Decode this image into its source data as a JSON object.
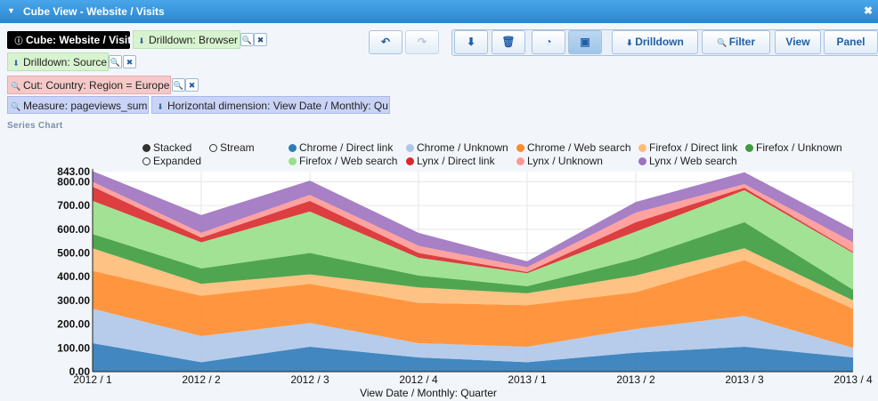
{
  "window": {
    "title": "Cube View - Website / Visits"
  },
  "chips": {
    "cube": "Cube: Website / Visits",
    "drilldown_browser": "Drilldown: Browser",
    "drilldown_source": "Drilldown: Source",
    "cut": "Cut: Country: Region = Europe",
    "measure": "Measure: pageviews_sum",
    "horizontal": "Horizontal dimension: View Date / Monthly: Qu"
  },
  "toolbar": {
    "drilldown_label": "Drilldown",
    "filter_label": "Filter",
    "view_label": "View",
    "panel_label": "Panel"
  },
  "section_title": "Series Chart",
  "chart_modes": {
    "stacked": "Stacked",
    "stream": "Stream",
    "expanded": "Expanded"
  },
  "chart_data": {
    "type": "area",
    "stacked": true,
    "xlabel": "View Date / Monthly: Quarter",
    "ylabel": "",
    "ylim": [
      0,
      843
    ],
    "y_top_label": "843.00",
    "y_ticks": [
      "0.00",
      "100.00",
      "200.00",
      "300.00",
      "400.00",
      "500.00",
      "600.00",
      "700.00",
      "800.00"
    ],
    "categories": [
      "2012 / 1",
      "2012 / 2",
      "2012 / 3",
      "2012 / 4",
      "2013 / 1",
      "2013 / 2",
      "2013 / 3",
      "2013 / 4"
    ],
    "series": [
      {
        "name": "Chrome / Direct link",
        "color": "#2e7ab8",
        "values": [
          120,
          40,
          105,
          60,
          40,
          80,
          105,
          60
        ]
      },
      {
        "name": "Chrome / Unknown",
        "color": "#aec7e8",
        "values": [
          145,
          110,
          100,
          60,
          65,
          100,
          130,
          40
        ]
      },
      {
        "name": "Chrome / Web search",
        "color": "#ff8b2a",
        "values": [
          160,
          170,
          165,
          170,
          175,
          155,
          235,
          165
        ]
      },
      {
        "name": "Firefox / Direct link",
        "color": "#ffbb78",
        "values": [
          95,
          50,
          40,
          65,
          50,
          70,
          50,
          35
        ]
      },
      {
        "name": "Firefox / Unknown",
        "color": "#3d9c3d",
        "values": [
          60,
          65,
          90,
          50,
          30,
          70,
          110,
          45
        ]
      },
      {
        "name": "Firefox / Web search",
        "color": "#98df8a",
        "values": [
          140,
          110,
          175,
          75,
          55,
          115,
          135,
          155
        ]
      },
      {
        "name": "Lynx / Direct link",
        "color": "#d9292b",
        "values": [
          60,
          20,
          45,
          20,
          5,
          40,
          10,
          5
        ]
      },
      {
        "name": "Lynx / Unknown",
        "color": "#ff9896",
        "values": [
          20,
          20,
          25,
          30,
          20,
          40,
          15,
          40
        ]
      },
      {
        "name": "Lynx / Web search",
        "color": "#9d72bf",
        "values": [
          45,
          75,
          60,
          55,
          25,
          45,
          50,
          55
        ]
      }
    ]
  }
}
